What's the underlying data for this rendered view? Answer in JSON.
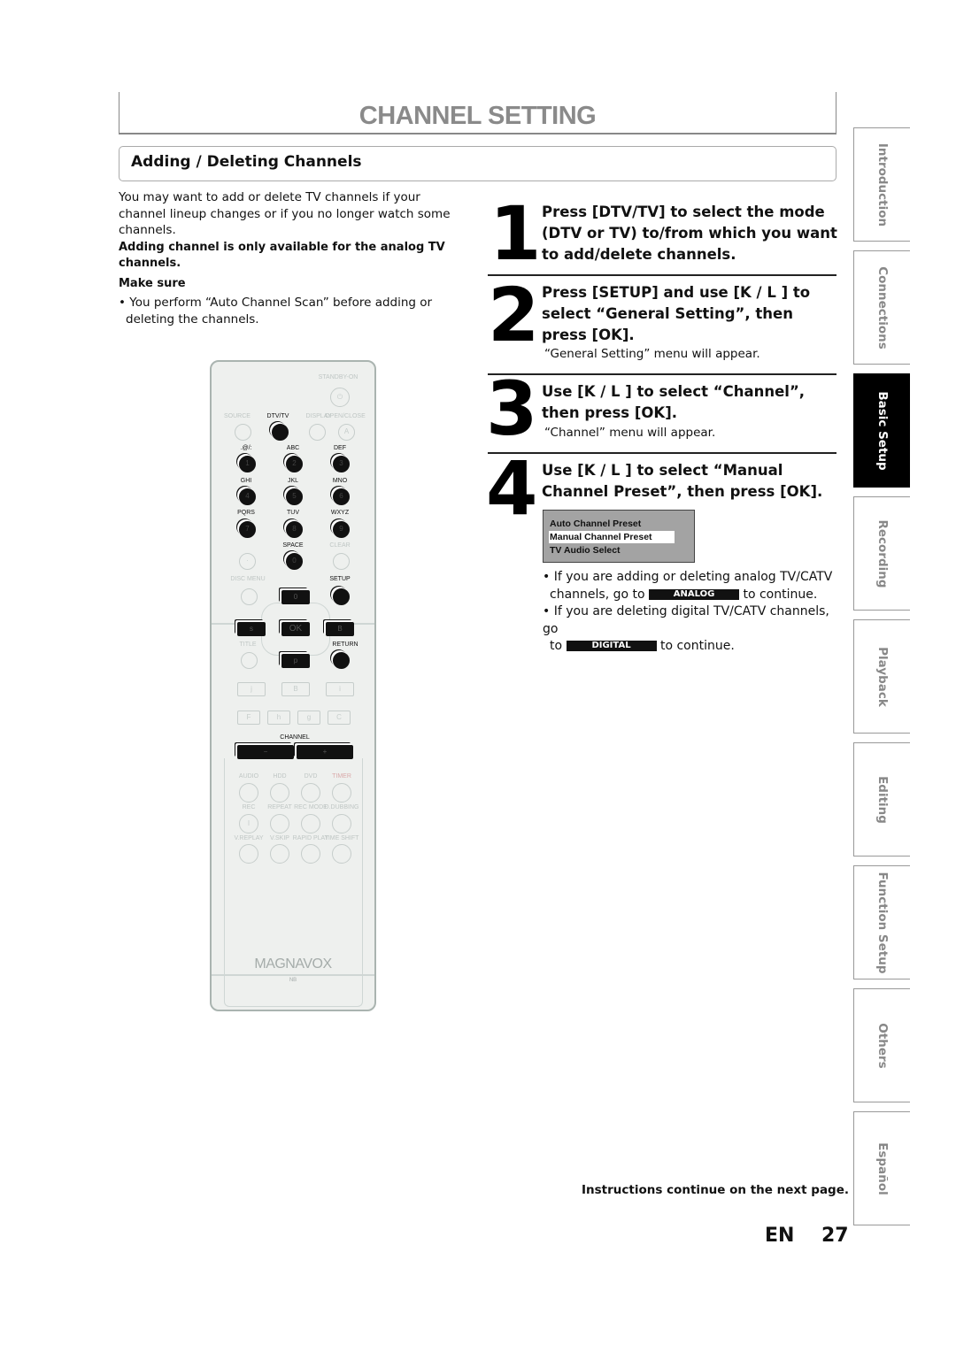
{
  "page": {
    "title": "CHANNEL SETTING",
    "section_title": "Adding / Deleting Channels",
    "intro": "You may want to add or delete TV channels if your channel lineup changes or if you no longer watch some channels.",
    "note": "Adding channel is only available for the analog TV channels.",
    "make_sure_label": "Make sure",
    "make_sure_bullet": "• You perform “Auto Channel Scan” before adding or deleting the channels.",
    "footer_note": "Instructions continue on the next page.",
    "lang": "EN",
    "page_number": "27"
  },
  "steps": [
    {
      "num": "1",
      "title": "Press [DTV/TV] to select the mode (DTV or TV) to/from which you want to add/delete channels.",
      "sub": ""
    },
    {
      "num": "2",
      "title": "Press [SETUP] and use [K / L ] to select “General Setting”, then press [OK].",
      "sub": "“General Setting” menu will appear."
    },
    {
      "num": "3",
      "title": "Use [K / L ] to select “Channel”, then press [OK].",
      "sub": "“Channel” menu will appear."
    },
    {
      "num": "4",
      "title": "Use [K / L ] to select “Manual Channel Preset”, then press [OK].",
      "sub": ""
    }
  ],
  "menu_screen": {
    "items": [
      "Auto Channel Preset",
      "Manual Channel Preset",
      "TV Audio Select"
    ],
    "selected_index": 1
  },
  "step4_bullets": {
    "analog_pre": "• If you are adding or deleting analog TV/CATV",
    "analog_line2_pre": "channels, go to",
    "analog_tag": "ANALOG",
    "analog_post": "to continue.",
    "digital_pre": "• If you are deleting digital TV/CATV channels, go",
    "digital_line2_pre": "to",
    "digital_tag": "DIGITAL",
    "digital_post": "to continue."
  },
  "side_tabs": [
    {
      "label": "Introduction",
      "active": false
    },
    {
      "label": "Connections",
      "active": false
    },
    {
      "label": "Basic Setup",
      "active": true
    },
    {
      "label": "Recording",
      "active": false
    },
    {
      "label": "Playback",
      "active": false
    },
    {
      "label": "Editing",
      "active": false
    },
    {
      "label": "Function Setup",
      "active": false
    },
    {
      "label": "Others",
      "active": false
    },
    {
      "label": "Español",
      "active": false
    }
  ],
  "remote": {
    "standby_label": "STANDBY-ON",
    "row1_labels": [
      "SOURCE",
      "DTV/TV",
      "DISPLAY",
      "OPEN/CLOSE"
    ],
    "openclose_glyph": "A",
    "num_labels": [
      ".@/:",
      "ABC",
      "DEF",
      "GHI",
      "JKL",
      "MNO",
      "PQRS",
      "TUV",
      "WXYZ"
    ],
    "num_keys": [
      "1",
      "2",
      "3",
      "4",
      "5",
      "6",
      "7",
      "8",
      "9"
    ],
    "space_label": "SPACE",
    "clear_label": "CLEAR",
    "zero_key": "0",
    "dot_key": "·",
    "disc_menu_label": "DISC MENU",
    "setup_label": "SETUP",
    "title_label": "TITLE",
    "return_label": "RETURN",
    "ok_label": "OK",
    "up_glyph": "0",
    "down_glyph": "p",
    "left_glyph": "s",
    "right_glyph": "B",
    "transport_row1": [
      "j",
      "B",
      "i"
    ],
    "transport_row2": [
      "F",
      "h",
      "g",
      "C"
    ],
    "channel_label": "CHANNEL",
    "channel_minus": "−",
    "channel_plus": "+",
    "row_a_labels": [
      "AUDIO",
      "HDD",
      "DVD",
      "TIMER"
    ],
    "row_b_labels": [
      "REC",
      "REPEAT",
      "REC MODE",
      "D.DUBBING"
    ],
    "row_c_labels": [
      "V.REPLAY",
      "V.SKIP",
      "RAPID PLAY",
      "TIME SHIFT"
    ],
    "rec_glyph": "I",
    "brand": "MAGNAVOX",
    "model": "NB"
  }
}
